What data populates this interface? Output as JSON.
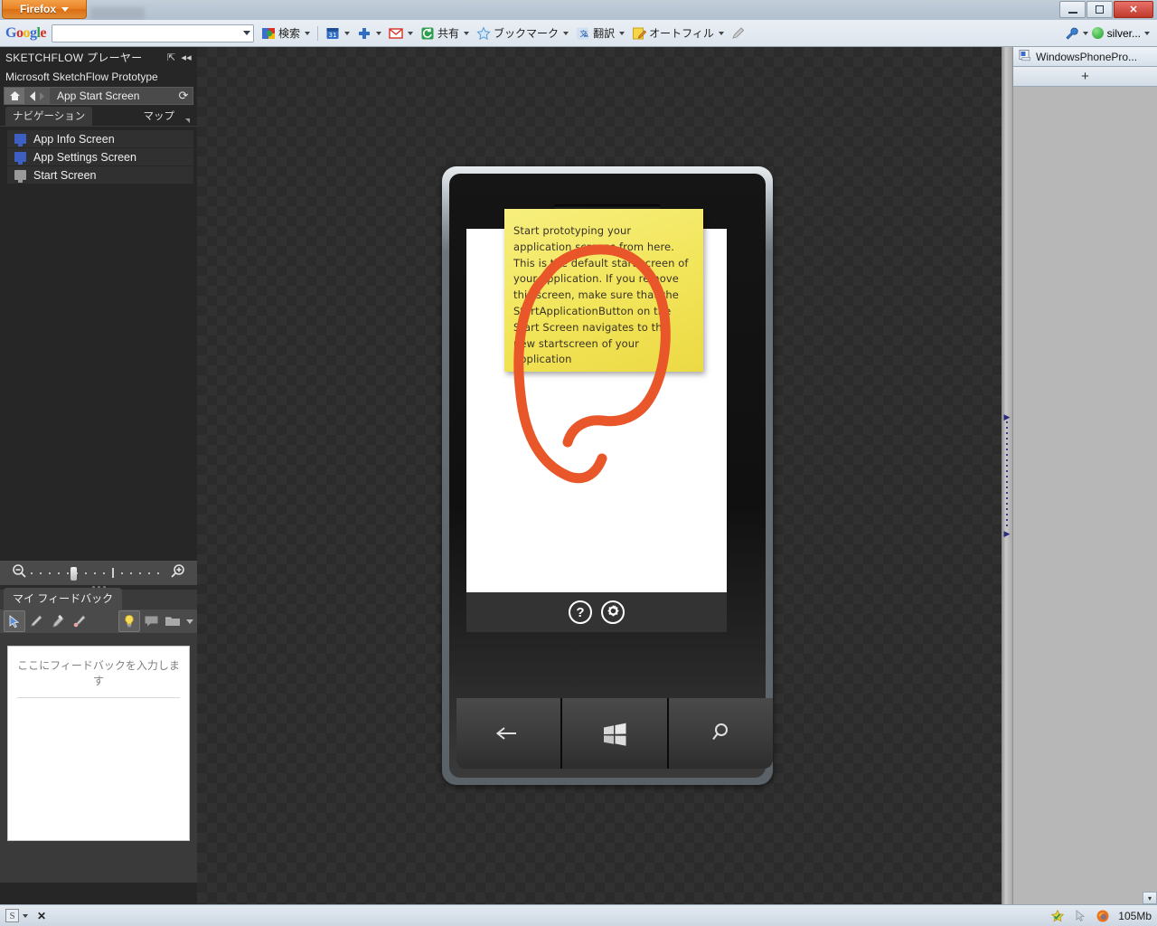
{
  "browser": {
    "firefox_button": "Firefox",
    "window_minimize": "minimize-window",
    "window_restore": "restore-window",
    "window_close": "✕"
  },
  "google_toolbar": {
    "logo": "Google",
    "search_value": "",
    "search_placeholder": "",
    "items": [
      {
        "label": "検索",
        "icon": "google-icon",
        "has_dropdown": true
      },
      {
        "label": "",
        "icon": "calendar-icon",
        "has_dropdown": true
      },
      {
        "label": "",
        "icon": "plus-one-icon",
        "has_dropdown": true
      },
      {
        "label": "",
        "icon": "gmail-icon",
        "has_dropdown": true
      },
      {
        "label": "共有",
        "icon": "share-icon",
        "has_dropdown": true
      },
      {
        "label": "ブックマーク",
        "icon": "star-icon",
        "has_dropdown": true
      },
      {
        "label": "翻訳",
        "icon": "translate-icon",
        "has_dropdown": true
      },
      {
        "label": "オートフィル",
        "icon": "autofill-icon",
        "has_dropdown": true
      },
      {
        "label": "",
        "icon": "pencil-icon",
        "has_dropdown": false
      }
    ],
    "right": {
      "settings_icon": "wrench-icon",
      "account_label": "silver...",
      "account_status_color": "#2e9e4f"
    }
  },
  "sketchflow": {
    "title": "SKETCHFLOW プレーヤー",
    "popout_icon": "popout-icon",
    "collapse_icon": "collapse-icon",
    "subtitle": "Microsoft SketchFlow Prototype",
    "navbar": {
      "home_icon": "home-icon",
      "back_icon": "back-arrow-icon",
      "forward_icon": "forward-arrow-icon",
      "current_screen": "App Start Screen",
      "refresh_icon": "refresh-icon"
    },
    "tabs": [
      {
        "label": "ナビゲーション",
        "active": true
      },
      {
        "label": "マップ",
        "active": false
      }
    ],
    "screens": [
      {
        "label": "App Info Screen",
        "icon": "screen-icon",
        "color": "blue"
      },
      {
        "label": "App Settings Screen",
        "icon": "screen-icon",
        "color": "blue"
      },
      {
        "label": "Start Screen",
        "icon": "screen-icon",
        "color": "gray"
      }
    ],
    "zoom": {
      "out_icon": "zoom-out-icon",
      "in_icon": "zoom-in-icon",
      "position_percent": 29
    }
  },
  "feedback": {
    "tab_label": "マイ フィードバック",
    "tools": [
      {
        "name": "select-tool",
        "icon": "cursor-icon",
        "selected": true
      },
      {
        "name": "pen-tool",
        "icon": "pen-icon",
        "selected": false
      },
      {
        "name": "highlighter-tool",
        "icon": "highlighter-icon",
        "selected": false
      },
      {
        "name": "eraser-tool",
        "icon": "eraser-brush-icon",
        "selected": false
      },
      {
        "name": "hint-tool",
        "icon": "lightbulb-icon",
        "selected": true
      },
      {
        "name": "comment-tool",
        "icon": "comment-icon",
        "selected": false
      },
      {
        "name": "folder-tool",
        "icon": "folder-icon",
        "selected": false
      }
    ],
    "input_placeholder": "ここにフィードバックを入力します"
  },
  "prototype": {
    "note_text": "Start prototyping your application screens from here. This is the default start screen of your application. If you remove this screen, make sure that the StartApplicationButton on the Start Screen navigates to the new startscreen of your application",
    "note_color": "#f2e559",
    "ink_color": "#e8562a",
    "appbar": [
      {
        "name": "help-button",
        "glyph": "?"
      },
      {
        "name": "settings-button",
        "glyph": "gear-icon"
      }
    ],
    "hardware_buttons": [
      {
        "name": "back-button",
        "glyph": "back-arrow-icon"
      },
      {
        "name": "start-button",
        "glyph": "windows-logo-icon"
      },
      {
        "name": "search-button",
        "glyph": "search-icon"
      }
    ]
  },
  "right_panel": {
    "tab_label": "WindowsPhonePro...",
    "tab_icon": "document-icon",
    "add_label": "+",
    "scroll_glyph": "▾"
  },
  "statusbar": {
    "left_icon": "silverlight-icon",
    "close_label": "✕",
    "memory": "105Mb",
    "icons": [
      "star-icon",
      "cursor-icon",
      "firefox-icon"
    ]
  }
}
